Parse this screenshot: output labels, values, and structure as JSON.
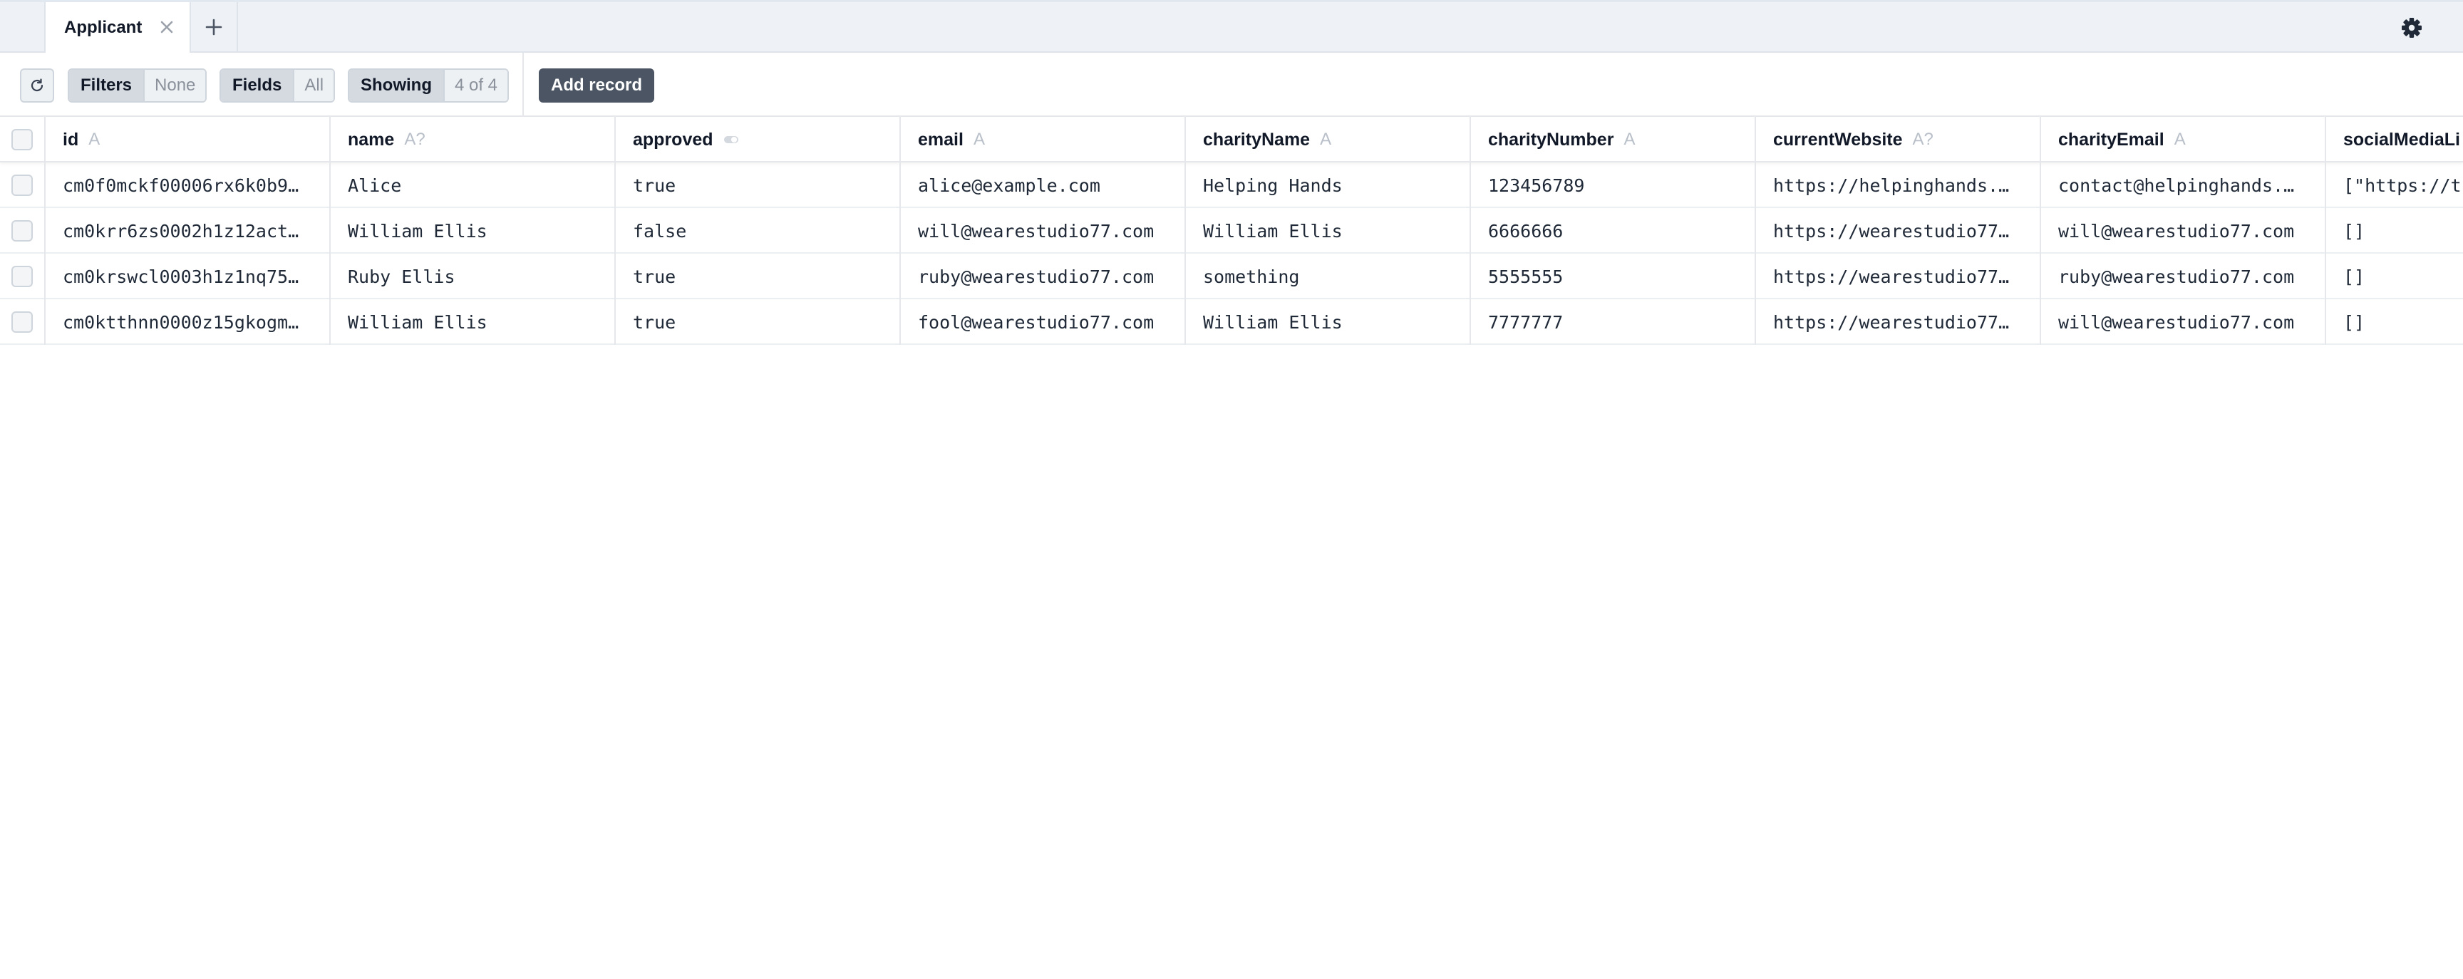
{
  "tabs": [
    {
      "label": "Applicant",
      "active": true
    }
  ],
  "toolbar": {
    "filters": {
      "label": "Filters",
      "value": "None"
    },
    "fields": {
      "label": "Fields",
      "value": "All"
    },
    "showing": {
      "label": "Showing",
      "value": "4 of 4"
    },
    "add_record_label": "Add record"
  },
  "colors": {
    "tabbar_bg": "#eef2f6",
    "button_dark": "#4b5563",
    "segment_key_bg": "#d5dae0",
    "type_hint": "#b9c0c9"
  },
  "icons": {
    "refresh": "refresh-icon",
    "close": "close-icon",
    "add": "plus-icon",
    "settings": "gear-icon"
  },
  "table": {
    "columns": [
      {
        "name": "id",
        "type": "A"
      },
      {
        "name": "name",
        "type": "A?"
      },
      {
        "name": "approved",
        "type": "toggle"
      },
      {
        "name": "email",
        "type": "A"
      },
      {
        "name": "charityName",
        "type": "A"
      },
      {
        "name": "charityNumber",
        "type": "A"
      },
      {
        "name": "currentWebsite",
        "type": "A?"
      },
      {
        "name": "charityEmail",
        "type": "A"
      },
      {
        "name": "socialMediaLi",
        "type": ""
      }
    ],
    "rows": [
      [
        "cm0f0mckf00006rx6k0b9…",
        "Alice",
        "true",
        "alice@example.com",
        "Helping Hands",
        "123456789",
        "https://helpinghands.…",
        "contact@helpinghands.…",
        "[\"https://t"
      ],
      [
        "cm0krr6zs0002h1z12act…",
        "William Ellis",
        "false",
        "will@wearestudio77.com",
        "William Ellis",
        "6666666",
        "https://wearestudio77…",
        "will@wearestudio77.com",
        "[]"
      ],
      [
        "cm0krswcl0003h1z1nq75…",
        "Ruby Ellis",
        "true",
        "ruby@wearestudio77.com",
        "something",
        "5555555",
        "https://wearestudio77…",
        "ruby@wearestudio77.com",
        "[]"
      ],
      [
        "cm0ktthnn0000z15gkogm…",
        "William Ellis",
        "true",
        "fool@wearestudio77.com",
        "William Ellis",
        "7777777",
        "https://wearestudio77…",
        "will@wearestudio77.com",
        "[]"
      ]
    ]
  }
}
